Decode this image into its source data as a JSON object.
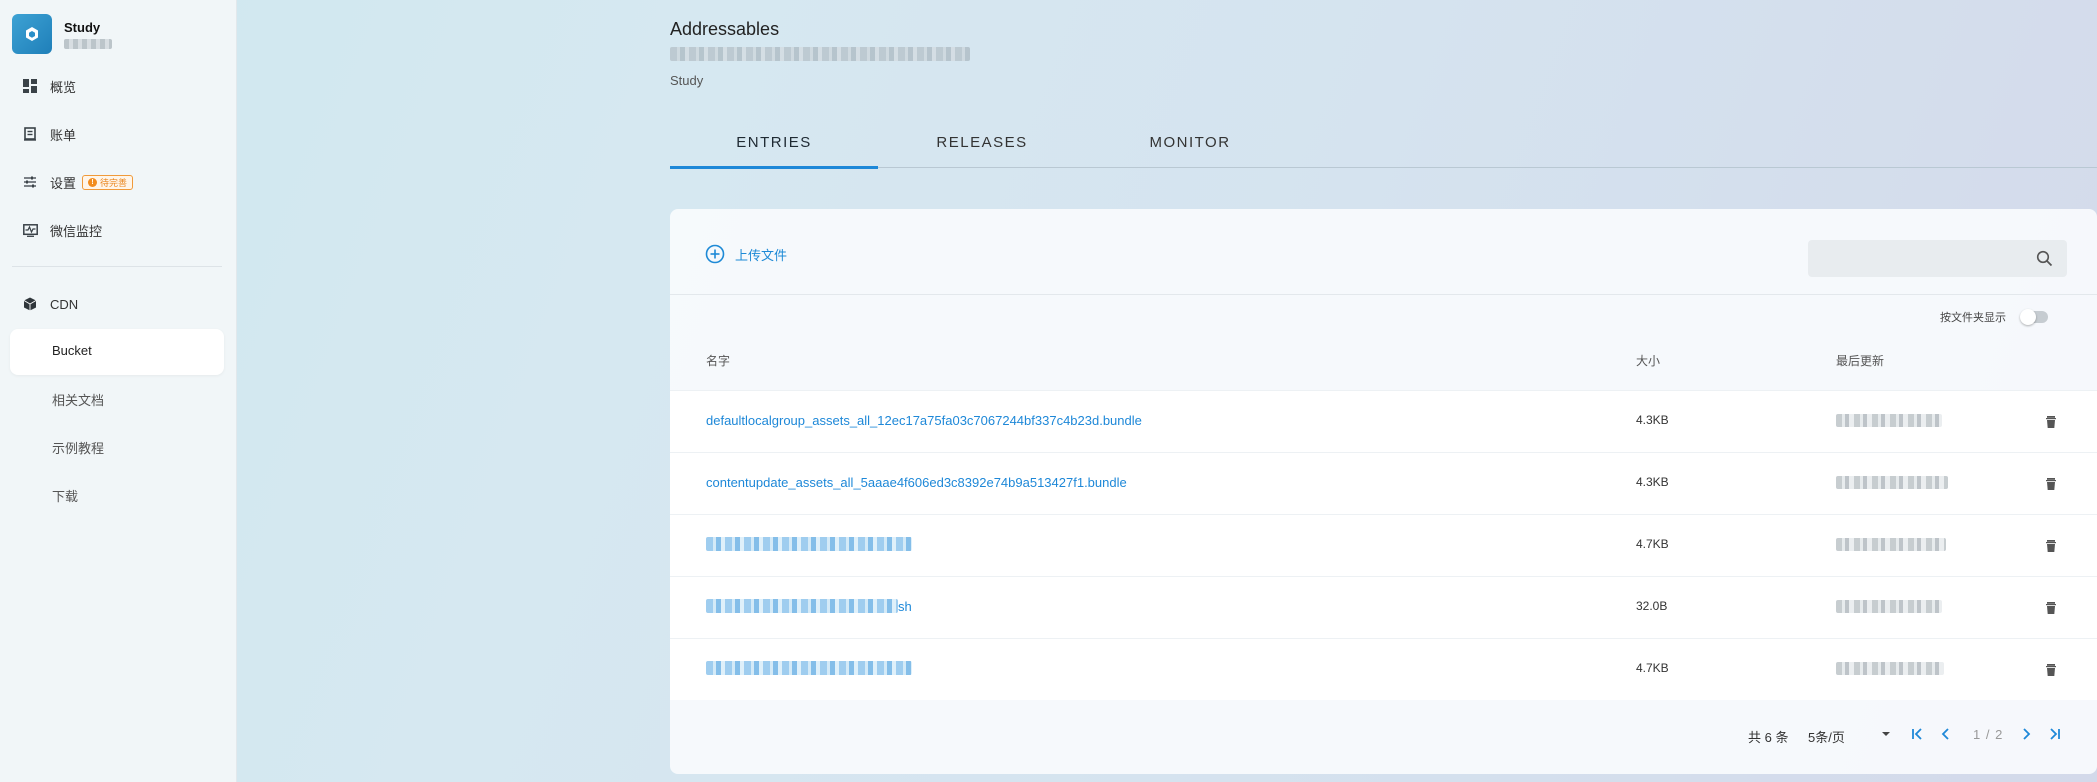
{
  "sidebar": {
    "brand_title": "Study",
    "nav": [
      {
        "label": "概览",
        "icon": "dashboard-icon"
      },
      {
        "label": "账单",
        "icon": "bill-icon"
      },
      {
        "label": "设置",
        "icon": "settings-sliders-icon",
        "badge": "待完善"
      },
      {
        "label": "微信监控",
        "icon": "monitor-icon"
      }
    ],
    "cdn": {
      "label": "CDN",
      "icon": "cube-icon"
    },
    "sub": [
      {
        "label": "Bucket",
        "active": true
      },
      {
        "label": "相关文档"
      },
      {
        "label": "示例教程"
      },
      {
        "label": "下载"
      }
    ]
  },
  "header": {
    "title": "Addressables",
    "breadcrumb": "Study"
  },
  "tabs": [
    "ENTRIES",
    "RELEASES",
    "MONITOR"
  ],
  "toolbar": {
    "upload_label": "上传文件",
    "search_placeholder": "",
    "folder_toggle_label": "按文件夹显示"
  },
  "table": {
    "headers": {
      "name": "名字",
      "size": "大小",
      "updated": "最后更新"
    },
    "rows": [
      {
        "name": "defaultlocalgroup_assets_all_12ec17a75fa03c7067244bf337c4b23d.bundle",
        "size": "4.3KB"
      },
      {
        "name": "contentupdate_assets_all_5aaae4f606ed3c8392e74b9a513427f1.bundle",
        "size": "4.3KB"
      },
      {
        "name": "",
        "size": "4.7KB"
      },
      {
        "name": "sh",
        "size": "32.0B"
      },
      {
        "name": "",
        "size": "4.7KB"
      }
    ]
  },
  "pagination": {
    "total": "共 6 条",
    "page_size": "5条/页",
    "page": "1 / 2"
  },
  "colors": {
    "accent": "#1e88d8",
    "badge": "#f28c1e"
  }
}
